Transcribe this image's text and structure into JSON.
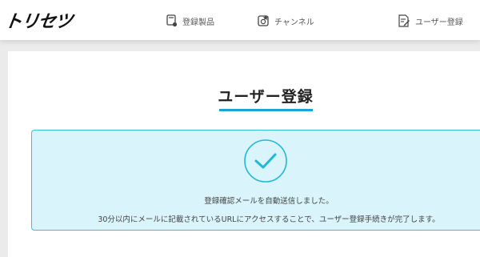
{
  "header": {
    "logo": "トリセツ",
    "nav": {
      "products": {
        "label": "登録製品",
        "icon": "registered-products-icon"
      },
      "channel": {
        "label": "チャンネル",
        "icon": "channel-icon"
      },
      "register": {
        "label": "ユーザー登録",
        "icon": "user-register-icon"
      }
    }
  },
  "main": {
    "title": "ユーザー登録",
    "notice": {
      "icon": "check-circle-icon",
      "line1": "登録確認メールを自動送信しました。",
      "line2": "30分以内にメールに記載されているURLにアクセスすることで、ユーザー登録手続きが完了します。"
    }
  },
  "colors": {
    "accent": "#1aa3d4",
    "notice_bg": "#d9f4fa",
    "notice_border": "#34c3dd",
    "check": "#1fb8d6"
  }
}
